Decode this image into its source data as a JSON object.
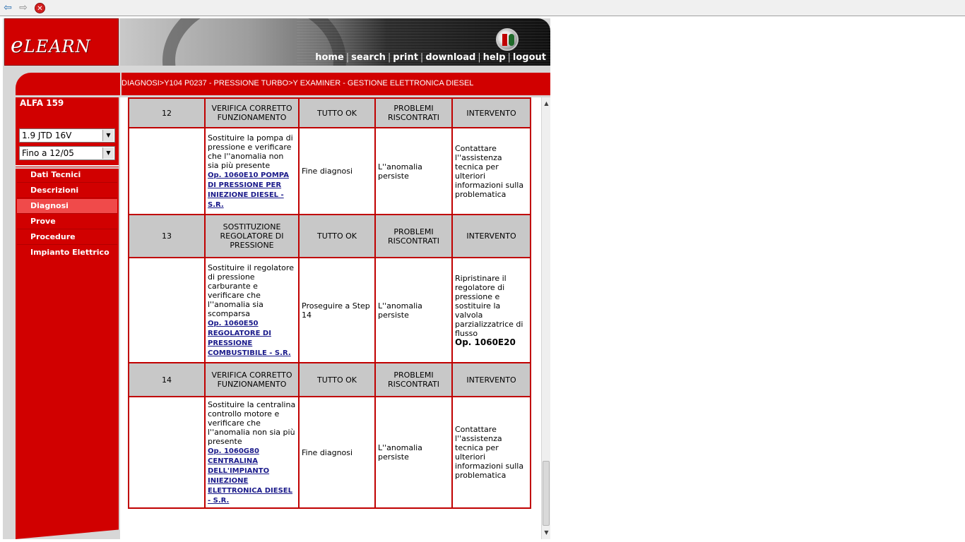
{
  "browser": {
    "back_icon": "back-arrow-icon",
    "forward_icon": "forward-arrow-icon",
    "stop_icon": "stop-icon"
  },
  "header": {
    "logo_e": "e",
    "logo_rest": "LEARN",
    "nav": [
      {
        "label": "home"
      },
      {
        "label": "search"
      },
      {
        "label": "print"
      },
      {
        "label": "download"
      },
      {
        "label": "help"
      },
      {
        "label": "logout"
      }
    ],
    "nav_separator": "|"
  },
  "breadcrumb": "DIAGNOSI>Y104 P0237 - PRESSIONE TURBO>Y EXAMINER - GESTIONE ELETTRONICA DIESEL",
  "sidebar": {
    "title": "ALFA 159",
    "engine_select": "1.9 JTD 16V",
    "period_select": "Fino a 12/05",
    "items": [
      {
        "label": "Dati Tecnici"
      },
      {
        "label": "Descrizioni"
      },
      {
        "label": "Diagnosi"
      },
      {
        "label": "Prove"
      },
      {
        "label": "Procedure"
      },
      {
        "label": "Impianto Elettrico"
      }
    ],
    "active_index": 2
  },
  "table": {
    "steps": [
      {
        "num": "12",
        "title": "VERIFICA CORRETTO FUNZIONAMENTO",
        "ok_header": "TUTTO OK",
        "problem_header": "PROBLEMI RISCONTRATI",
        "action_header": "INTERVENTO",
        "description": "Sostituire la pompa di pressione e verificare che l''anomalia non sia più presente",
        "op_link": " Op. 1060E10 POMPA DI PRESSIONE PER INIEZIONE DIESEL - S.R.",
        "ok_result": "Fine diagnosi",
        "problem_result": "L''anomalia persiste",
        "action": "Contattare l''assistenza tecnica per ulteriori informazioni sulla problematica",
        "action_op": ""
      },
      {
        "num": "13",
        "title": "SOSTITUZIONE REGOLATORE DI PRESSIONE",
        "ok_header": "TUTTO OK",
        "problem_header": "PROBLEMI RISCONTRATI",
        "action_header": "INTERVENTO",
        "description": "Sostituire il regolatore di pressione carburante e verificare che l''anomalia sia scomparsa",
        "op_link": " Op. 1060E50 REGOLATORE DI PRESSIONE COMBUSTIBILE - S.R.",
        "ok_result": "Proseguire a Step 14",
        "problem_result": "L''anomalia persiste",
        "action": "Ripristinare il regolatore di pressione e sostituire la valvola parzializzatrice di flusso",
        "action_op": "Op. 1060E20"
      },
      {
        "num": "14",
        "title": "VERIFICA CORRETTO FUNZIONAMENTO",
        "ok_header": "TUTTO OK",
        "problem_header": "PROBLEMI RISCONTRATI",
        "action_header": "INTERVENTO",
        "description": "Sostituire la centralina controllo motore e verificare che l''anomalia non sia più presente",
        "op_link": " Op. 1060G80 CENTRALINA DELL'IMPIANTO INIEZIONE ELETTRONICA DIESEL - S.R.",
        "ok_result": "Fine diagnosi",
        "problem_result": "L''anomalia persiste",
        "action": "Contattare l''assistenza tecnica per ulteriori informazioni sulla problematica",
        "action_op": ""
      }
    ]
  }
}
